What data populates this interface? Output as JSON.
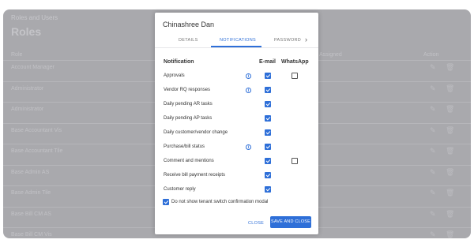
{
  "background": {
    "breadcrumb": "Roles and Users",
    "title": "Roles",
    "columns": {
      "role": "Role",
      "assigned": "Assigned",
      "action": "Action"
    },
    "rows": [
      "Account Manager",
      "Administrator",
      "Administrator",
      "Base Accountant Vis",
      "Base Accountant Tile",
      "Base Admin AS",
      "Base Admin Tile",
      "Base Bill CM AS",
      "Base Bill CM Vis"
    ]
  },
  "modal": {
    "title": "Chinashree Dan",
    "tabs": [
      {
        "label": "DETAILS",
        "active": false
      },
      {
        "label": "NOTIFICATIONS",
        "active": true
      },
      {
        "label": "PASSWORD",
        "active": false
      }
    ],
    "columns": {
      "notification": "Notification",
      "email": "E-mail",
      "whatsapp": "WhatsApp"
    },
    "rows": [
      {
        "label": "Approvals",
        "info": true,
        "email": true,
        "whatsapp": false
      },
      {
        "label": "Vendor RQ responses",
        "info": true,
        "email": true,
        "whatsapp": null
      },
      {
        "label": "Daily pending AR tasks",
        "info": false,
        "email": true,
        "whatsapp": null
      },
      {
        "label": "Daily pending AP tasks",
        "info": false,
        "email": true,
        "whatsapp": null
      },
      {
        "label": "Daily customer/vendor change",
        "info": false,
        "email": true,
        "whatsapp": null
      },
      {
        "label": "Purchase/bill status",
        "info": true,
        "email": true,
        "whatsapp": null
      },
      {
        "label": "Comment and mentions",
        "info": false,
        "email": true,
        "whatsapp": false
      },
      {
        "label": "Receive bill payment receipts",
        "info": false,
        "email": true,
        "whatsapp": null
      },
      {
        "label": "Customer reply",
        "info": false,
        "email": true,
        "whatsapp": null
      }
    ],
    "dont_show_label": "Do not show tenant switch confirmation modal",
    "dont_show_checked": true,
    "close_label": "CLOSE",
    "save_label": "SAVE AND CLOSE"
  },
  "colors": {
    "accent": "#2e6fd8",
    "overlay": "#a9a9ad"
  }
}
